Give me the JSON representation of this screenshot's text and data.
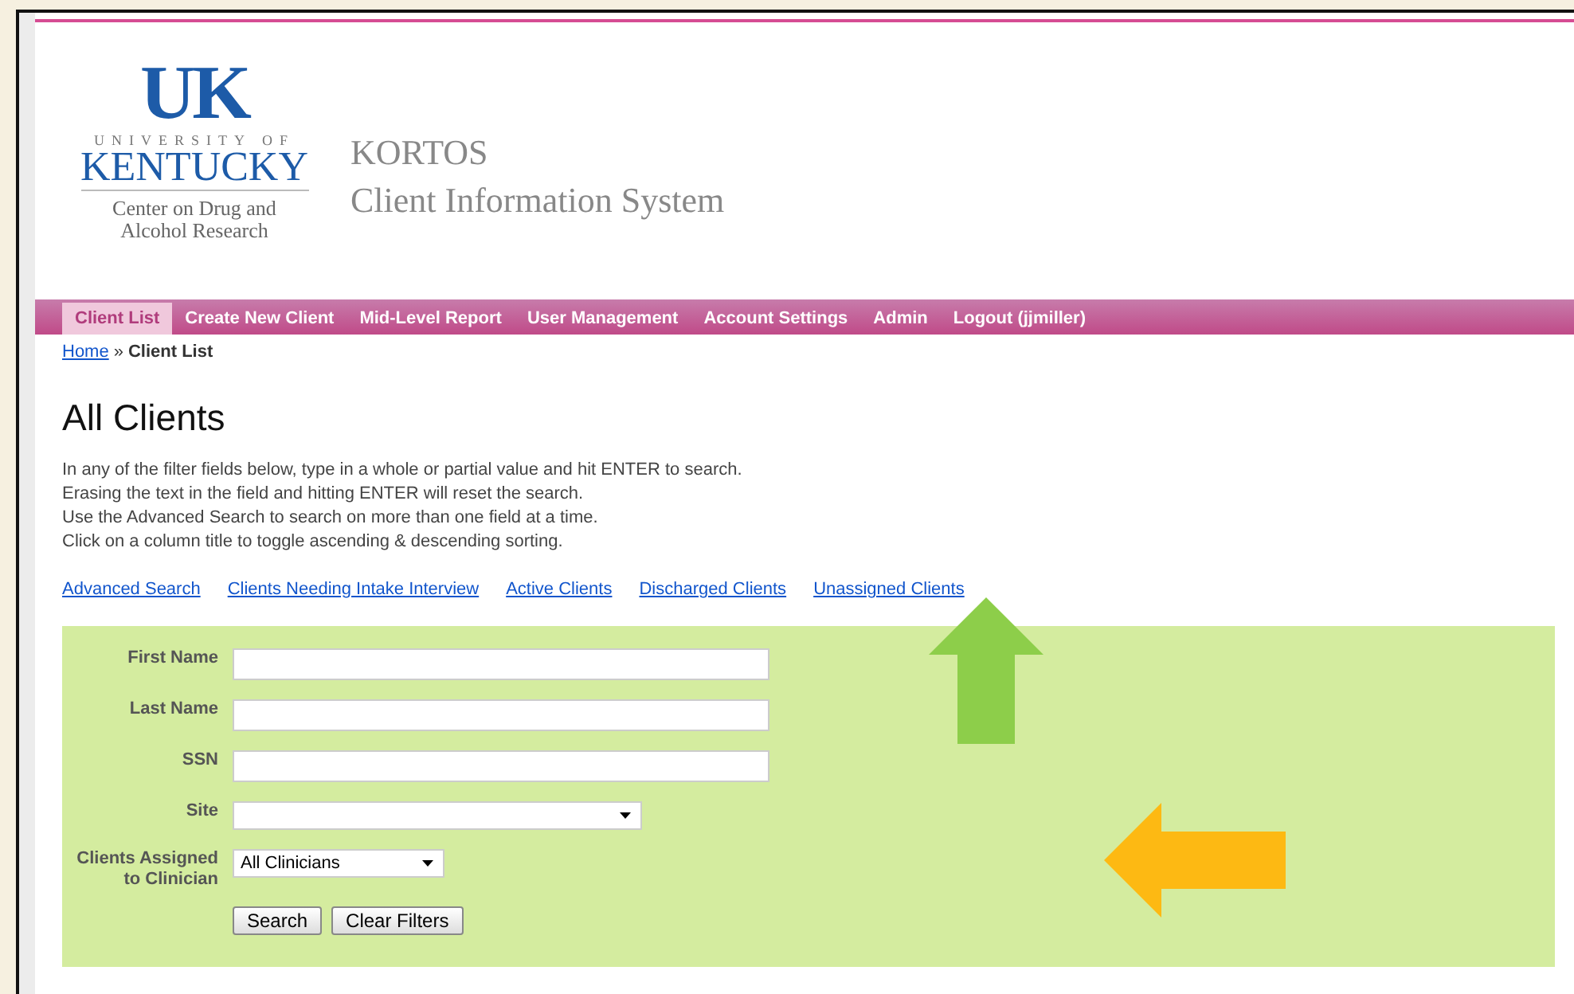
{
  "logo": {
    "mark": "UK",
    "university": "UNIVERSITY OF",
    "name": "KENTUCKY",
    "center": "Center on Drug and Alcohol Research"
  },
  "site_title": {
    "line1": "KORTOS",
    "line2": "Client Information System"
  },
  "nav": [
    {
      "label": "Client List",
      "selected": true
    },
    {
      "label": "Create New Client",
      "selected": false
    },
    {
      "label": "Mid-Level Report",
      "selected": false
    },
    {
      "label": "User Management",
      "selected": false
    },
    {
      "label": "Account Settings",
      "selected": false
    },
    {
      "label": "Admin",
      "selected": false
    },
    {
      "label": "Logout (jjmiller)",
      "selected": false
    }
  ],
  "breadcrumb": {
    "link": "Home",
    "separator": "»",
    "current": "Client List"
  },
  "heading": "All Clients",
  "instructions": [
    "In any of the filter fields below, type in a whole or partial value and hit ENTER to search.",
    "Erasing the text in the field and hitting ENTER will reset the search.",
    "Use the Advanced Search to search on more than one field at a time.",
    "Click on a column title to toggle ascending & descending sorting."
  ],
  "links": [
    "Advanced Search",
    "Clients Needing Intake Interview",
    "Active Clients",
    "Discharged Clients",
    "Unassigned Clients"
  ],
  "filters": [
    {
      "kind": "text",
      "label": "First Name"
    },
    {
      "kind": "text",
      "label": "Last Name"
    },
    {
      "kind": "text",
      "label": "SSN"
    },
    {
      "kind": "select",
      "label": "Site"
    },
    {
      "kind": "select",
      "label": "Clients Assigned to Clinician",
      "value": "All Clinicians"
    }
  ],
  "buttons": [
    "Search",
    "Clear Filters"
  ],
  "annotations": [
    {
      "kind": "up",
      "color": "#8dce4a"
    },
    {
      "kind": "left",
      "color": "#fdb913"
    }
  ]
}
